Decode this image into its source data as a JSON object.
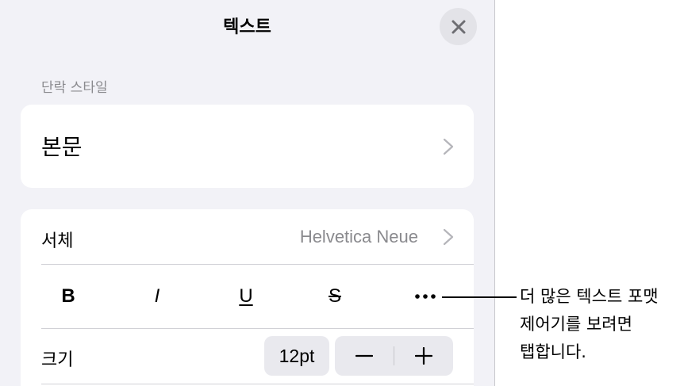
{
  "panel": {
    "title": "텍스트",
    "close_icon": "close-icon"
  },
  "paragraph_style": {
    "section_label": "단락 스타일",
    "value": "본문"
  },
  "font": {
    "label": "서체",
    "value": "Helvetica Neue"
  },
  "format_buttons": {
    "bold": "B",
    "italic": "I",
    "underline": "U",
    "strikethrough": "S",
    "more_icon": "more-icon"
  },
  "size": {
    "label": "크기",
    "value": "12pt",
    "decrement_icon": "minus-icon",
    "increment_icon": "plus-icon"
  },
  "callout": {
    "lines": [
      "더 많은 텍스트 포맷",
      "제어기를 보려면",
      "탭합니다."
    ]
  },
  "colors": {
    "panel_background": "#f2f2f7",
    "card_background": "#ffffff",
    "secondary_text": "#8a8a8e",
    "control_background": "#e9e9ee"
  }
}
